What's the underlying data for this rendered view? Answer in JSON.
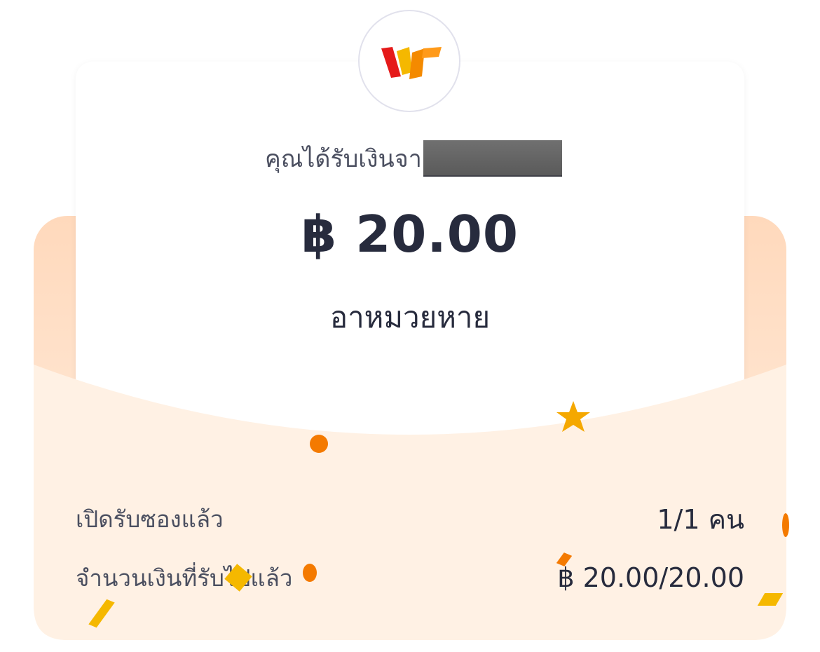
{
  "sender": {
    "prefix": "คุณได้รับเงินจา",
    "name_redacted": true
  },
  "amount": "฿ 20.00",
  "message": "อาหมวยหาย",
  "summary": {
    "opened_label": "เปิดรับซองแล้ว",
    "opened_value": "1/1 คน",
    "received_label": "จำนวนเงินที่รับไปแล้ว",
    "received_value": "฿ 20.00/20.00"
  },
  "colors": {
    "accent": "#ff8a00",
    "envelope": "#ffe6d2",
    "text_primary": "#272b3d",
    "text_secondary": "#4b4f60"
  },
  "logo": {
    "icon": "truemoney-wallet-logo-icon"
  }
}
